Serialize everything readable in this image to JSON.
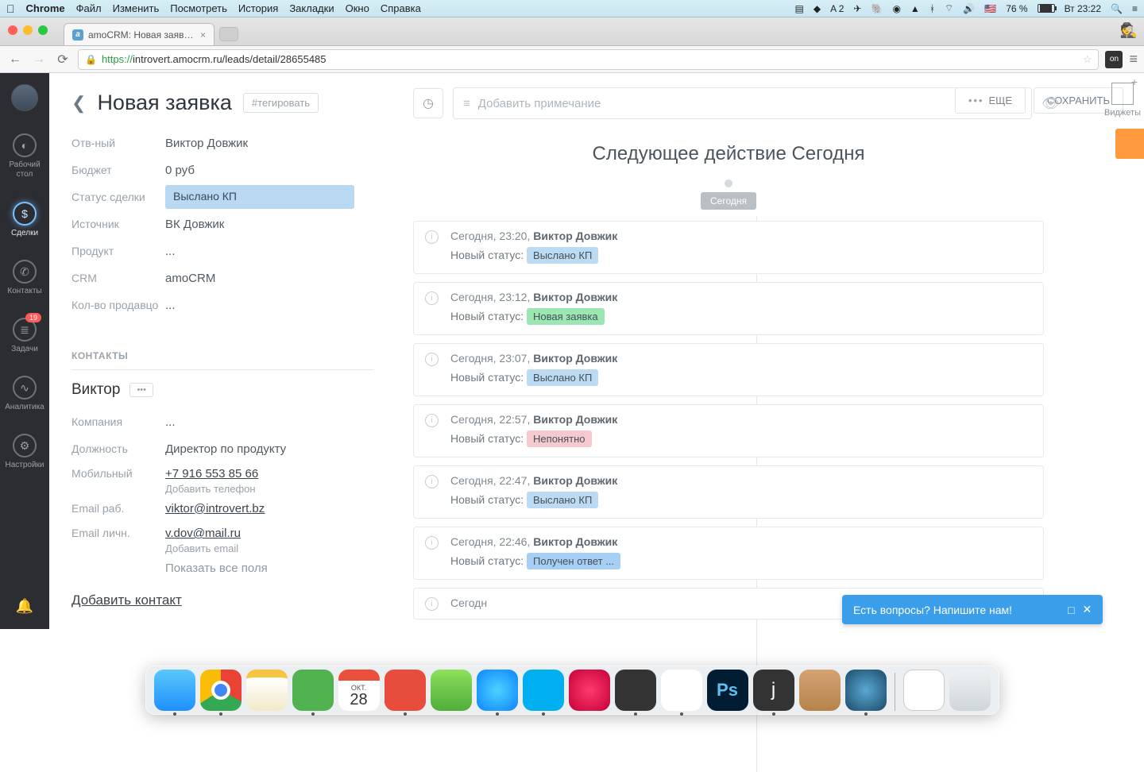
{
  "menubar": {
    "app": "Chrome",
    "items": [
      "Файл",
      "Изменить",
      "Посмотреть",
      "История",
      "Закладки",
      "Окно",
      "Справка"
    ],
    "right": {
      "adobe": "A 2",
      "battery": "76 %",
      "time": "Вт 23:22"
    }
  },
  "browser": {
    "tab_title": "amoCRM: Новая заявка, ...",
    "url_scheme": "https://",
    "url_rest": "introvert.amocrm.ru/leads/detail/28655485",
    "ext_label": "on"
  },
  "sidenav": {
    "items": [
      {
        "icon": "gauge",
        "label": "Рабочий стол"
      },
      {
        "icon": "$",
        "label": "Сделки",
        "active": true
      },
      {
        "icon": "phone",
        "label": "Контакты"
      },
      {
        "icon": "list",
        "label": "Задачи",
        "badge": "19"
      },
      {
        "icon": "chart",
        "label": "Аналитика"
      },
      {
        "icon": "gear",
        "label": "Настройки"
      }
    ]
  },
  "header": {
    "title": "Новая заявка",
    "tag_placeholder": "#тегировать",
    "more_label": "ЕЩЕ",
    "save_label": "СОХРАНИТЬ",
    "widgets_label": "Виджеты"
  },
  "fields": {
    "responsible": {
      "label": "Отв-ный",
      "value": "Виктор Довжик"
    },
    "budget": {
      "label": "Бюджет",
      "value": "0 руб"
    },
    "status": {
      "label": "Статус сделки",
      "value": "Выслано КП"
    },
    "source": {
      "label": "Источник",
      "value": "ВК Довжик"
    },
    "product": {
      "label": "Продукт",
      "value": "..."
    },
    "crm": {
      "label": "CRM",
      "value": "amoCRM"
    },
    "sellers": {
      "label": "Кол-во продавцо",
      "value": "..."
    }
  },
  "contacts": {
    "section": "КОНТАКТЫ",
    "name": "Виктор",
    "company": {
      "label": "Компания",
      "value": "..."
    },
    "position": {
      "label": "Должность",
      "value": "Директор по продукту"
    },
    "mobile": {
      "label": "Мобильный",
      "value": "+7 916 553 85 66",
      "add": "Добавить телефон"
    },
    "email_work": {
      "label": "Email раб.",
      "value": "viktor@introvert.bz"
    },
    "email_pers": {
      "label": "Email личн.",
      "value": "v.dov@mail.ru",
      "add": "Добавить email"
    },
    "show_all": "Показать все поля",
    "add_contact": "Добавить контакт"
  },
  "note": {
    "placeholder": "Добавить примечание"
  },
  "timeline": {
    "title": "Следующее действие Сегодня",
    "today": "Сегодня",
    "status_label": "Новый статус:",
    "events": [
      {
        "time": "Сегодня, 23:20,",
        "author": "Виктор Довжик",
        "status": "Выслано КП",
        "cls": "st-blue"
      },
      {
        "time": "Сегодня, 23:12,",
        "author": "Виктор Довжик",
        "status": "Новая заявка",
        "cls": "st-green"
      },
      {
        "time": "Сегодня, 23:07,",
        "author": "Виктор Довжик",
        "status": "Выслано КП",
        "cls": "st-blue"
      },
      {
        "time": "Сегодня, 22:57,",
        "author": "Виктор Довжик",
        "status": "Непонятно",
        "cls": "st-pink"
      },
      {
        "time": "Сегодня, 22:47,",
        "author": "Виктор Довжик",
        "status": "Выслано КП",
        "cls": "st-blue"
      },
      {
        "time": "Сегодня, 22:46,",
        "author": "Виктор Довжик",
        "status": "Получен ответ ...",
        "cls": "st-azure"
      },
      {
        "time": "Сегодн",
        "author": "",
        "status": "",
        "cls": "st-blue",
        "truncated": true
      }
    ]
  },
  "chat": {
    "text": "Есть вопросы? Напишите нам!"
  },
  "calendar": {
    "month": "ОКТ.",
    "day": "28"
  }
}
